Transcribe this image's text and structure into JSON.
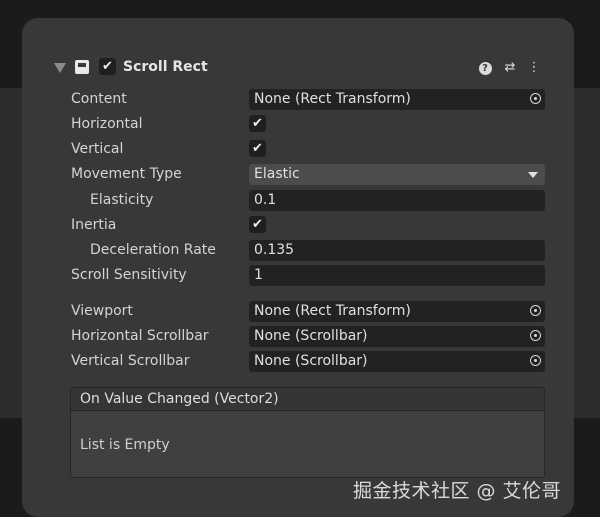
{
  "component": {
    "title": "Scroll Rect",
    "enabled": true,
    "header_icons": [
      "help-icon",
      "preset-icon",
      "context-menu-icon"
    ]
  },
  "properties": {
    "content": {
      "label": "Content",
      "value": "None (Rect Transform)"
    },
    "horizontal": {
      "label": "Horizontal",
      "checked": true
    },
    "vertical": {
      "label": "Vertical",
      "checked": true
    },
    "movement_type": {
      "label": "Movement Type",
      "value": "Elastic"
    },
    "elasticity": {
      "label": "Elasticity",
      "value": "0.1"
    },
    "inertia": {
      "label": "Inertia",
      "checked": true
    },
    "deceleration_rate": {
      "label": "Deceleration Rate",
      "value": "0.135"
    },
    "scroll_sensitivity": {
      "label": "Scroll Sensitivity",
      "value": "1"
    },
    "viewport": {
      "label": "Viewport",
      "value": "None (Rect Transform)"
    },
    "horizontal_scrollbar": {
      "label": "Horizontal Scrollbar",
      "value": "None (Scrollbar)"
    },
    "vertical_scrollbar": {
      "label": "Vertical Scrollbar",
      "value": "None (Scrollbar)"
    }
  },
  "event": {
    "title": "On Value Changed (Vector2)",
    "empty_text": "List is Empty"
  },
  "check_glyph": "✔",
  "watermark": "掘金技术社区 @ 艾伦哥"
}
